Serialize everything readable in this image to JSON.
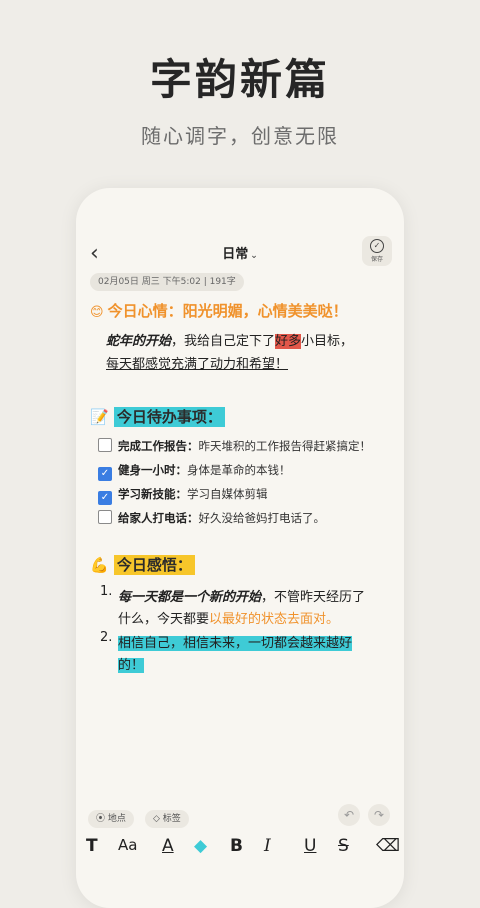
{
  "hero": {
    "title": "字韵新篇",
    "subtitle": "随心调字，创意无限"
  },
  "nav": {
    "back": "‹",
    "title": "日常",
    "chevron": "⌄",
    "save_label": "保存"
  },
  "meta": {
    "text": "02月05日  周三  下午5:02  |  191字"
  },
  "mood": {
    "emoji": "😊",
    "text": "今日心情：阳光明媚，心情美美哒！"
  },
  "intro": {
    "calligraphy": "蛇年的开始",
    "part1": "，我给自己定下了",
    "highlight": "好多",
    "part2": "小目标，",
    "line2": "每天都感觉充满了动力和希望！"
  },
  "todo": {
    "emoji": "📝",
    "heading": "今日待办事项：",
    "items": [
      {
        "title": "完成工作报告：",
        "desc": "昨天堆积的工作报告得赶紧搞定！",
        "checked": false
      },
      {
        "title": "健身一小时：",
        "desc": "身体是革命的本钱！",
        "checked": true
      },
      {
        "title": "学习新技能：",
        "desc": "学习自媒体剪辑",
        "checked": true
      },
      {
        "title": "给家人打电话：",
        "desc": "好久没给爸妈打电话了。",
        "checked": false
      }
    ]
  },
  "feel": {
    "emoji": "💪",
    "heading": "今日感悟：",
    "n1": "1.",
    "p1_bold": "每一天都是一个新的开始",
    "p1_rest": "，不管昨天经历了",
    "p1_line2_a": "什么，今天都要",
    "p1_line2_b": "以最好的状态去面对。",
    "n2": "2.",
    "p2_line1": "相信自己，相信未来，一切都会越来越好",
    "p2_line2": "的！"
  },
  "chips": {
    "location": "地点",
    "tag": "标签"
  },
  "toolbar": [
    "T",
    "Aa",
    "A",
    "◆",
    "B",
    "I",
    "U",
    "S",
    "⌫"
  ]
}
